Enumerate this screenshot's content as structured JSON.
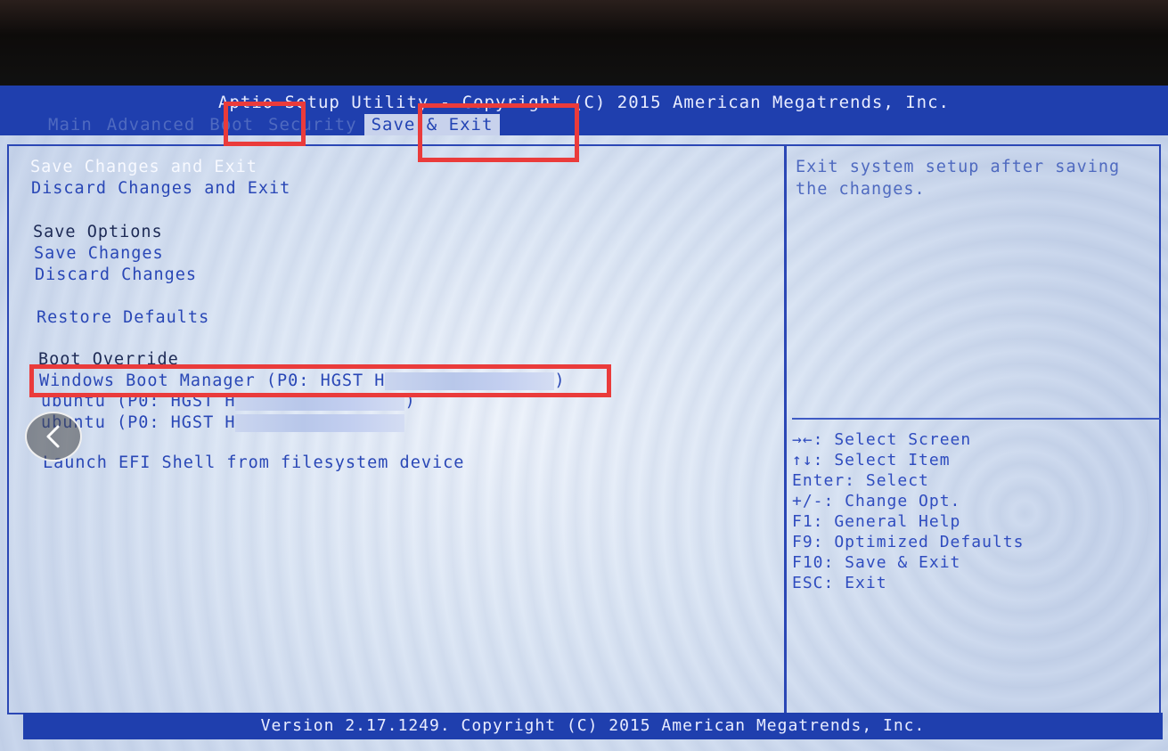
{
  "title": "Aptio Setup Utility - Copyright (C) 2015 American Megatrends, Inc.",
  "tabs": [
    {
      "label": "Main"
    },
    {
      "label": "Advanced"
    },
    {
      "label": "Boot"
    },
    {
      "label": "Security"
    },
    {
      "label": "Save & Exit"
    }
  ],
  "menu": {
    "save_changes_and_exit": "Save Changes and Exit",
    "discard_changes_and_exit": "Discard Changes and Exit",
    "save_options_header": "Save Options",
    "save_changes": "Save Changes",
    "discard_changes": "Discard Changes",
    "restore_defaults": "Restore Defaults",
    "boot_override_header": "Boot Override",
    "boot_windows": "Windows Boot Manager (P0: HGST H",
    "boot_windows_end": ")",
    "boot_ubuntu_1": "ubuntu (P0: HGST H",
    "boot_ubuntu_1_end": ")",
    "boot_ubuntu_2": "ubuntu (P0: HGST H",
    "launch_efi_shell": "Launch EFI Shell from filesystem device"
  },
  "help": {
    "description": "Exit system setup after saving the changes.",
    "keys": [
      "→←: Select Screen",
      "↑↓: Select Item",
      "Enter: Select",
      "+/-: Change Opt.",
      "F1: General Help",
      "F9: Optimized Defaults",
      "F10: Save & Exit",
      "ESC: Exit"
    ]
  },
  "footer": "Version 2.17.1249. Copyright (C) 2015 American Megatrends, Inc.",
  "colors": {
    "bar_blue": "#1f3fae",
    "panel_bg": "#dde7f5",
    "highlight_red": "#ea3b3b"
  },
  "icons": {
    "back": "chevron-left-icon"
  }
}
